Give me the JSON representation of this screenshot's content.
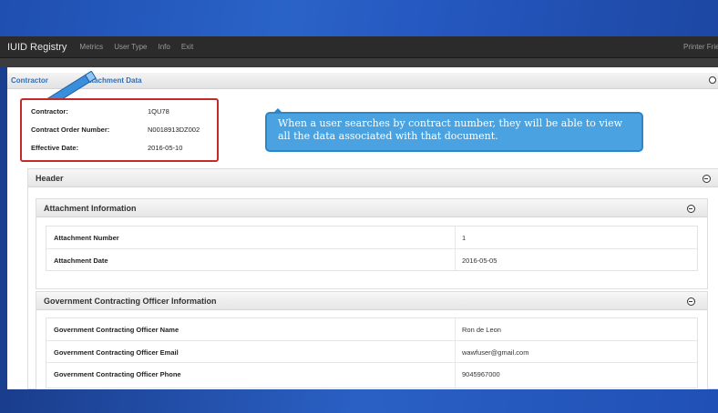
{
  "navbar": {
    "brand": "IUID Registry",
    "links": [
      "Metrics",
      "User Type",
      "Info",
      "Exit"
    ],
    "right_link": "Printer Frien"
  },
  "breadcrumb": {
    "contractor": "Contractor",
    "attachment_data": "Attachment Data"
  },
  "summary": {
    "contractor_label": "Contractor:",
    "contractor_value": "1QU78",
    "order_label": "Contract Order Number:",
    "order_value": "N0018913DZ002",
    "effective_label": "Effective Date:",
    "effective_value": "2016-05-10"
  },
  "callout": {
    "text": "When a user searches by contract number, they will be able to view all the data associated with that document."
  },
  "header_section": {
    "title": "Header"
  },
  "attachment_section": {
    "title": "Attachment Information",
    "rows": [
      {
        "label": "Attachment Number",
        "value": "1"
      },
      {
        "label": "Attachment Date",
        "value": "2016-05-05"
      }
    ]
  },
  "officer_section": {
    "title": "Government Contracting Officer Information",
    "rows": [
      {
        "label": "Government Contracting Officer Name",
        "value": "Ron de Leon"
      },
      {
        "label": "Government Contracting Officer Email",
        "value": "wawfuser@gmail.com"
      },
      {
        "label": "Government Contracting Officer Phone",
        "value": "9045967000"
      }
    ]
  },
  "colors": {
    "background_blue": "#1a3f8e",
    "navbar": "#2b2b2b",
    "link_blue": "#2f6fb8",
    "highlight_red": "#c52a2a",
    "callout_blue": "#4aa3e0"
  }
}
